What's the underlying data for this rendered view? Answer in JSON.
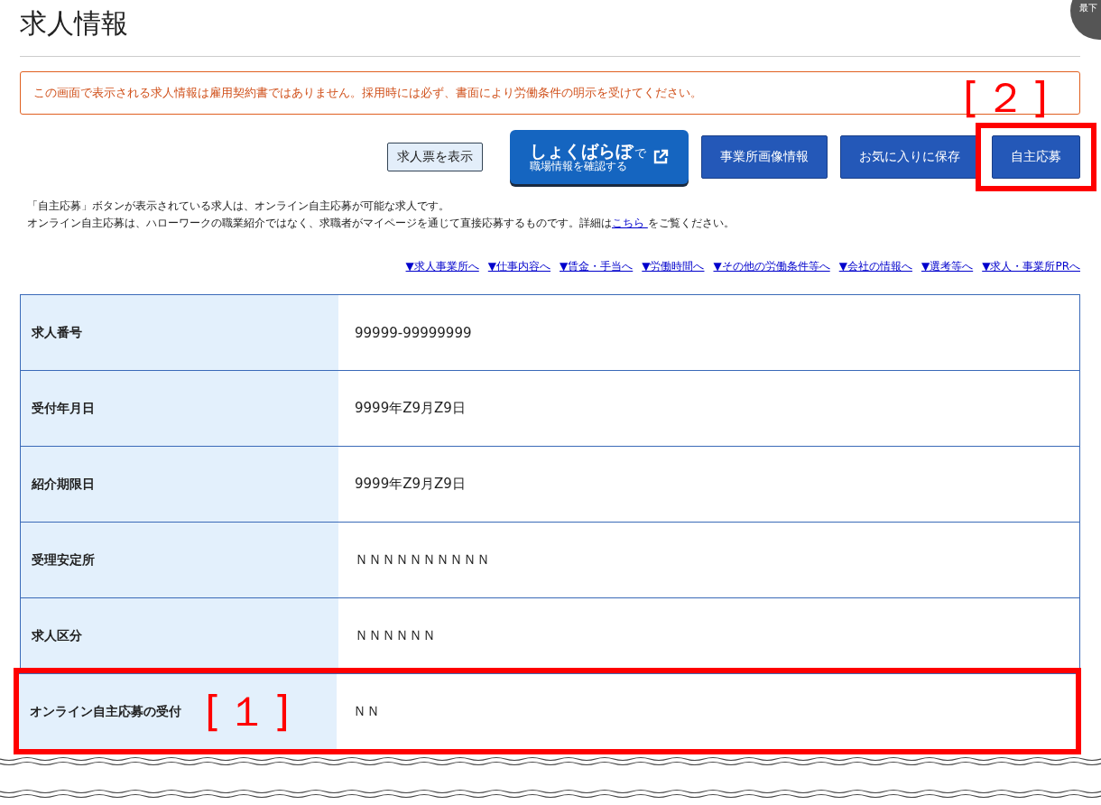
{
  "title": "求人情報",
  "scroll_button": {
    "label": "最下"
  },
  "notice": "この画面で表示される求人情報は雇用契約書ではありません。採用時には必ず、書面により労働条件の明示を受けてください。",
  "actions": [
    {
      "kind": "plain",
      "label": "求人票を表示"
    },
    {
      "kind": "brand",
      "label": "しょくばらぼ",
      "suffix": "で",
      "sub": "職場情報を確認する"
    },
    {
      "kind": "primary",
      "label": "事業所画像情報"
    },
    {
      "kind": "primary",
      "label": "お気に入りに保存"
    },
    {
      "kind": "primary",
      "label": "自主応募",
      "callout": "[２]"
    }
  ],
  "notes": [
    {
      "text": "「自主応募」ボタンが表示されている求人は、オンライン自主応募が可能な求人です。"
    },
    {
      "text": "オンライン自主応募は、ハローワークの職業紹介ではなく、求職者がマイページを通じて直接応募するものです。詳細は",
      "link": "こちら ",
      "after": "をご覧ください。"
    }
  ],
  "section_links": [
    "▼求人事業所へ",
    "▼仕事内容へ",
    "▼賃金・手当へ",
    "▼労働時間へ",
    "▼その他の労働条件等へ",
    "▼会社の情報へ",
    "▼選考等へ",
    "▼求人・事業所PRへ"
  ],
  "table": {
    "rows": [
      {
        "label": "求人番号",
        "value": "99999-99999999"
      },
      {
        "label": "受付年月日",
        "value": "9999年Z9月Z9日"
      },
      {
        "label": "紹介期限日",
        "value": "9999年Z9月Z9日"
      },
      {
        "label": "受理安定所",
        "value": "ＮＮＮＮＮＮＮＮＮＮ"
      },
      {
        "label": "求人区分",
        "value": "ＮＮＮＮＮＮ"
      },
      {
        "label": "オンライン自主応募の受付",
        "value": "ＮＮ",
        "callout": "[１]"
      }
    ]
  }
}
